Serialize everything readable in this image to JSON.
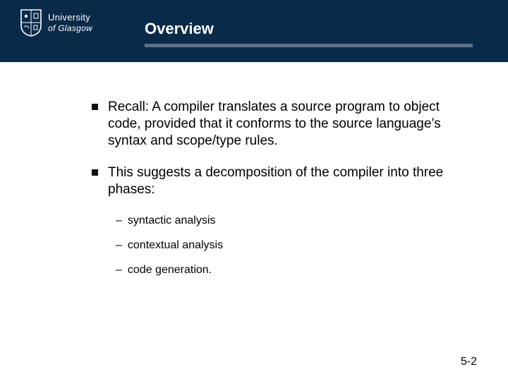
{
  "header": {
    "logo": {
      "line1": "University",
      "line2": "of",
      "line3": "Glasgow"
    },
    "title": "Overview"
  },
  "bullets": [
    {
      "text": "Recall: A compiler translates a source program to object code, provided that it conforms to the source language’s syntax and scope/type rules."
    },
    {
      "text": "This suggests a decomposition of the compiler into three phases:",
      "subs": [
        "syntactic analysis",
        "contextual analysis",
        "code generation."
      ]
    }
  ],
  "footer": {
    "page": "5-2"
  }
}
